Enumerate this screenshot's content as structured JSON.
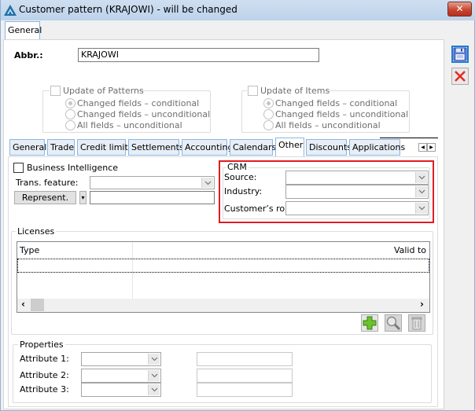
{
  "window": {
    "title": "Customer pattern (KRAJOWI) - will be changed",
    "close_label": "✕"
  },
  "outer_tabs": [
    {
      "label": "General",
      "active": true
    }
  ],
  "abbr": {
    "label": "Abbr.:",
    "value": "KRAJOWI"
  },
  "update_patterns": {
    "label": "Update of Patterns",
    "checked": false,
    "options": [
      {
        "label": "Changed fields – conditional",
        "selected": true
      },
      {
        "label": "Changed fields – unconditional",
        "selected": false
      },
      {
        "label": "All fields – unconditional",
        "selected": false
      }
    ]
  },
  "update_items": {
    "label": "Update of Items",
    "checked": false,
    "options": [
      {
        "label": "Changed fields – conditional",
        "selected": true
      },
      {
        "label": "Changed fields – unconditional",
        "selected": false
      },
      {
        "label": "All fields – unconditional",
        "selected": false
      }
    ]
  },
  "tabs": [
    {
      "label": "General"
    },
    {
      "label": "Trade"
    },
    {
      "label": "Credit limits"
    },
    {
      "label": "Settlements"
    },
    {
      "label": "Accounting"
    },
    {
      "label": "Calendars"
    },
    {
      "label": "Other",
      "active": true
    },
    {
      "label": "Discounts"
    },
    {
      "label": "Applications"
    }
  ],
  "tab_scroll": {
    "left": "◀",
    "right": "▶"
  },
  "other": {
    "business_intelligence": {
      "label": "Business Intelligence",
      "checked": false
    },
    "trans_feature": {
      "label": "Trans. feature:",
      "value": ""
    },
    "represent": {
      "button_label": "Represent.",
      "dropdown_glyph": "▾",
      "value": ""
    }
  },
  "crm": {
    "legend": "CRM",
    "source": {
      "label": "Source:",
      "value": ""
    },
    "industry": {
      "label": "Industry:",
      "value": ""
    },
    "customer_role": {
      "label": "Customer’s role:",
      "value": ""
    },
    "highlight_color": "#e01c24"
  },
  "licenses": {
    "legend": "Licenses",
    "columns": [
      "Type",
      "Valid to"
    ],
    "rows": [],
    "scroll_left": "‹",
    "scroll_right": "›"
  },
  "properties": {
    "legend": "Properties",
    "attributes": [
      {
        "label": "Attribute 1:",
        "value": "",
        "text": ""
      },
      {
        "label": "Attribute 2:",
        "value": "",
        "text": ""
      },
      {
        "label": "Attribute 3:",
        "value": "",
        "text": ""
      }
    ]
  }
}
